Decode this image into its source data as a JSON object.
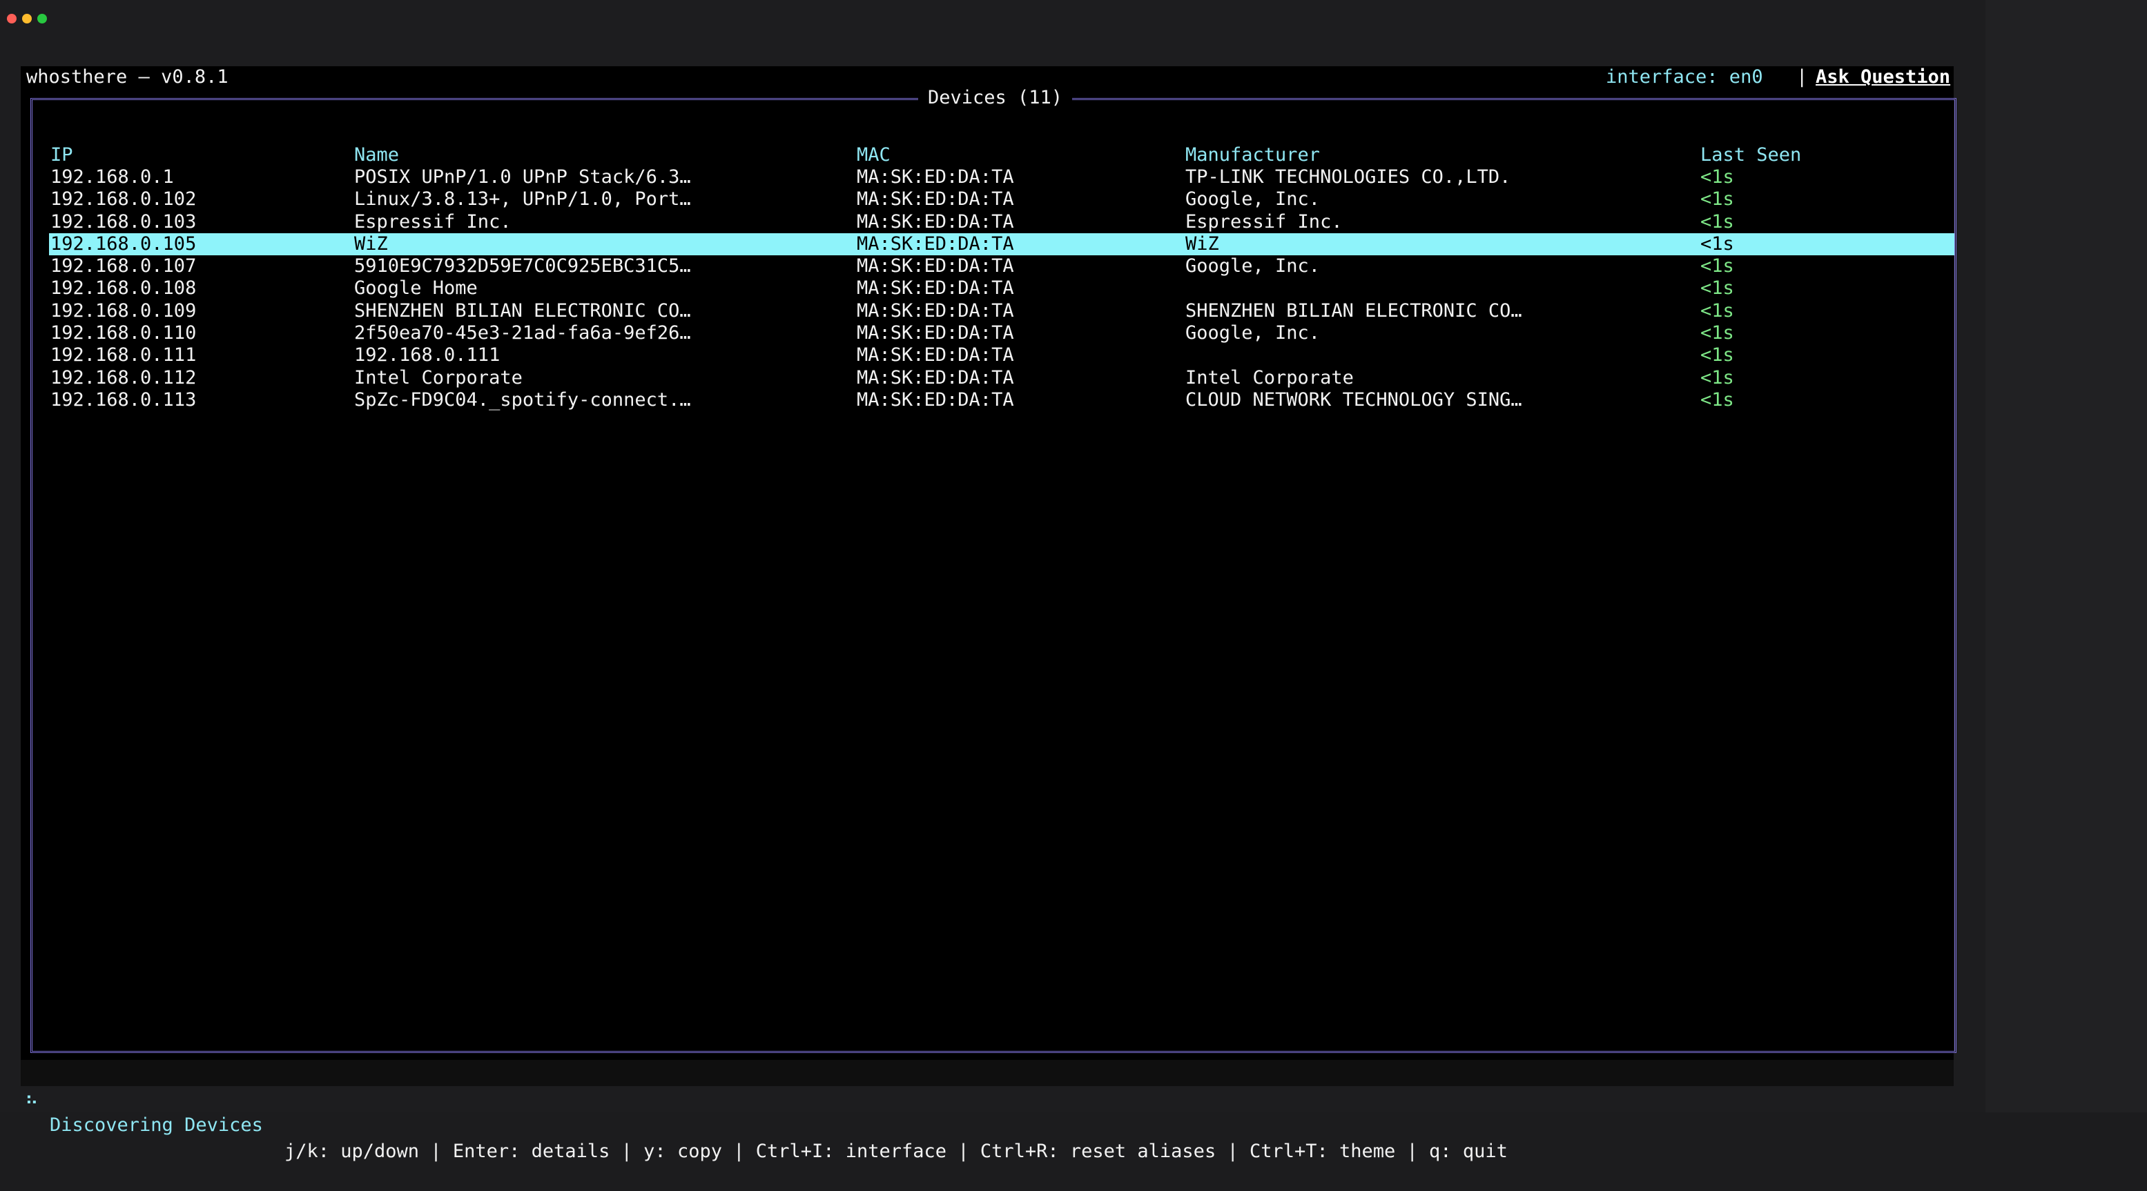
{
  "app": {
    "title": "whosthere – v0.8.1",
    "interface_label": "interface: en0",
    "separator": "|",
    "ask_question": "Ask Question"
  },
  "table": {
    "title": "Devices (11)",
    "columns": {
      "ip": "IP",
      "name": "Name",
      "mac": "MAC",
      "manufacturer": "Manufacturer",
      "last_seen": "Last Seen"
    },
    "selected_index": 3,
    "rows": [
      {
        "ip": "192.168.0.1",
        "name": "POSIX UPnP/1.0 UPnP Stack/6.3…",
        "mac": "MA:SK:ED:DA:TA",
        "manufacturer": "TP-LINK TECHNOLOGIES CO.,LTD.",
        "last_seen": "<1s"
      },
      {
        "ip": "192.168.0.102",
        "name": "Linux/3.8.13+, UPnP/1.0, Port…",
        "mac": "MA:SK:ED:DA:TA",
        "manufacturer": "Google, Inc.",
        "last_seen": "<1s"
      },
      {
        "ip": "192.168.0.103",
        "name": "Espressif Inc.",
        "mac": "MA:SK:ED:DA:TA",
        "manufacturer": "Espressif Inc.",
        "last_seen": "<1s"
      },
      {
        "ip": "192.168.0.105",
        "name": "WiZ",
        "mac": "MA:SK:ED:DA:TA",
        "manufacturer": "WiZ",
        "last_seen": "<1s"
      },
      {
        "ip": "192.168.0.107",
        "name": "5910E9C7932D59E7C0C925EBC31C5…",
        "mac": "MA:SK:ED:DA:TA",
        "manufacturer": "Google, Inc.",
        "last_seen": "<1s"
      },
      {
        "ip": "192.168.0.108",
        "name": "Google Home",
        "mac": "MA:SK:ED:DA:TA",
        "manufacturer": "",
        "last_seen": "<1s"
      },
      {
        "ip": "192.168.0.109",
        "name": "SHENZHEN BILIAN ELECTRONIC CO…",
        "mac": "MA:SK:ED:DA:TA",
        "manufacturer": "SHENZHEN BILIAN ELECTRONIC CO…",
        "last_seen": "<1s"
      },
      {
        "ip": "192.168.0.110",
        "name": "2f50ea70-45e3-21ad-fa6a-9ef26…",
        "mac": "MA:SK:ED:DA:TA",
        "manufacturer": "Google, Inc.",
        "last_seen": "<1s"
      },
      {
        "ip": "192.168.0.111",
        "name": "192.168.0.111",
        "mac": "MA:SK:ED:DA:TA",
        "manufacturer": "",
        "last_seen": "<1s"
      },
      {
        "ip": "192.168.0.112",
        "name": "Intel Corporate",
        "mac": "MA:SK:ED:DA:TA",
        "manufacturer": "Intel Corporate",
        "last_seen": "<1s"
      },
      {
        "ip": "192.168.0.113",
        "name": "SpZc-FD9C04._spotify-connect.…",
        "mac": "MA:SK:ED:DA:TA",
        "manufacturer": "CLOUD NETWORK TECHNOLOGY SING…",
        "last_seen": "<1s"
      }
    ]
  },
  "status": {
    "spinner": "⠦",
    "label": "Discovering Devices",
    "hints": "j/k: up/down | Enter: details | y: copy | Ctrl+I: interface | Ctrl+R: reset aliases | Ctrl+T: theme | q: quit"
  },
  "colors": {
    "accent_cyan": "#8fe6f2",
    "selection": "#8ef3fa",
    "border": "#7b6fd6",
    "last_seen_green": "#7ee787"
  }
}
